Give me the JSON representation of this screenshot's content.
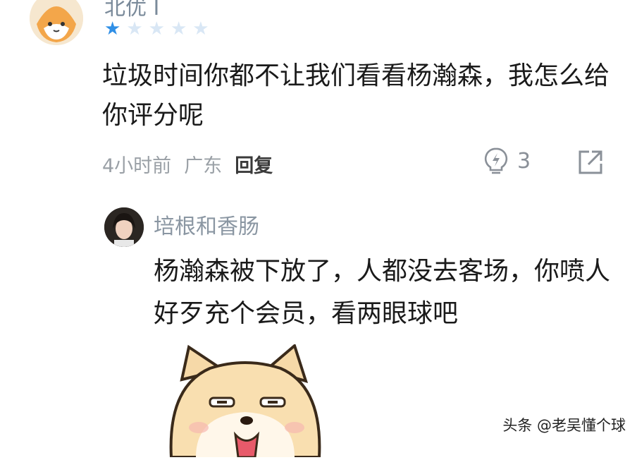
{
  "comment": {
    "username": "北优 I",
    "rating": {
      "value": 1,
      "max": 5
    },
    "text": "垃圾时间你都不让我们看看杨瀚森，我怎么给你评分呢",
    "time": "4小时前",
    "location": "广东",
    "reply_label": "回复",
    "like_count": "3"
  },
  "reply": {
    "username": "培根和香肠",
    "text": "杨瀚森被下放了，人都没去客场，你喷人好歹充个会员，看两眼球吧"
  },
  "watermark": "头条 @老吴懂个球",
  "colors": {
    "star": "#2f8fe6",
    "star_empty": "#d9e7f5",
    "meta": "#9aa0a6"
  },
  "icons": [
    "fox-avatar",
    "star-icon",
    "like-bulb-icon",
    "share-icon",
    "user-avatar",
    "dog-sticker"
  ]
}
